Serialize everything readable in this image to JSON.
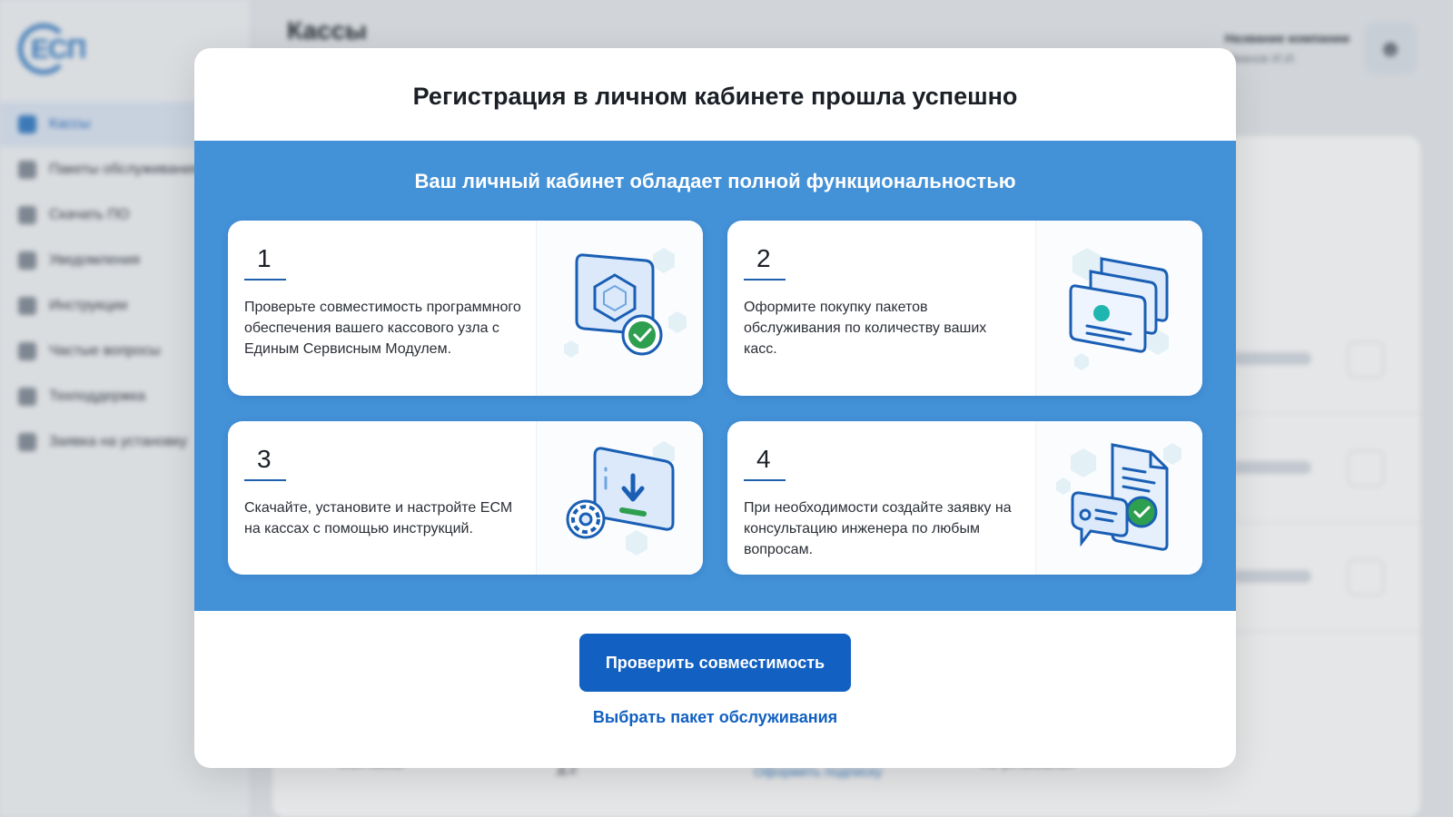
{
  "background": {
    "logo_text": "ЕСП",
    "page_title": "Кассы",
    "sidebar_items": [
      {
        "label": "Кассы",
        "icon": "cash-register-icon",
        "active": true
      },
      {
        "label": "Пакеты обслуживания",
        "icon": "package-icon",
        "active": false
      },
      {
        "label": "Скачать ПО",
        "icon": "download-icon",
        "active": false
      },
      {
        "label": "Уведомления",
        "icon": "bell-icon",
        "active": false
      },
      {
        "label": "Инструкции",
        "icon": "document-icon",
        "active": false
      },
      {
        "label": "Частые вопросы",
        "icon": "question-icon",
        "active": false
      },
      {
        "label": "Техподдержка",
        "icon": "support-icon",
        "active": false
      },
      {
        "label": "Заявка на установку",
        "icon": "request-icon",
        "active": false
      }
    ],
    "company_name": "Название компании",
    "user_name": "Иванов И.И.",
    "bottom_row": {
      "name": "Моя касса",
      "address": "Москва, Печатников пер., д.2",
      "subscribe_link": "Оформить подписку",
      "status": "Не установлен"
    }
  },
  "modal": {
    "title": "Регистрация в личном кабинете прошла успешно",
    "subtitle": "Ваш личный кабинет обладает полной функциональностью",
    "steps": [
      {
        "number": "1",
        "text": "Проверьте совместимость программного обеспечения вашего кассового узла с Единым Сервисным Модулем.",
        "icon": "compatibility-check-icon"
      },
      {
        "number": "2",
        "text": "Оформите покупку пакетов обслуживания по количеству ваших касс.",
        "icon": "service-packages-icon"
      },
      {
        "number": "3",
        "text": "Скачайте, установите и настройте ЕСМ на кассах с помощью инструкций.",
        "icon": "download-install-icon"
      },
      {
        "number": "4",
        "text": "При необходимости создайте заявку на консультацию инженера по любым вопросам.",
        "icon": "consultation-request-icon"
      }
    ],
    "primary_button": "Проверить совместимость",
    "secondary_link": "Выбрать пакет обслуживания"
  },
  "colors": {
    "panel_blue": "#4391d7",
    "button_blue": "#1160c2",
    "check_green": "#2e9e4f"
  }
}
